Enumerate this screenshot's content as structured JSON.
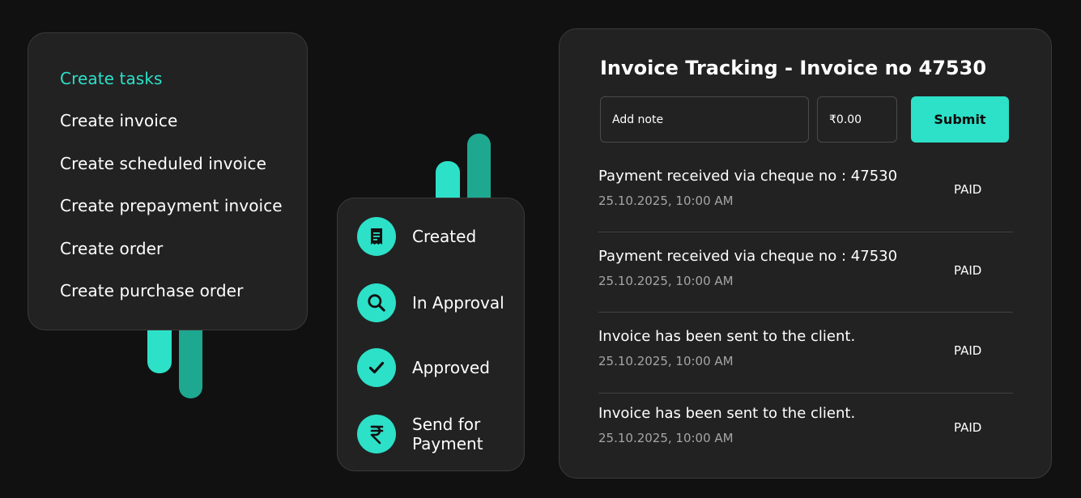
{
  "colors": {
    "accent": "#2de0c8",
    "accent_dark": "#1ea890",
    "card": "#222222",
    "background": "#111111"
  },
  "menu": {
    "items": [
      {
        "label": "Create tasks",
        "active": true
      },
      {
        "label": "Create invoice"
      },
      {
        "label": "Create scheduled invoice"
      },
      {
        "label": "Create prepayment invoice"
      },
      {
        "label": "Create order"
      },
      {
        "label": "Create purchase order"
      }
    ]
  },
  "status_steps": [
    {
      "label": "Created",
      "icon": "receipt-icon"
    },
    {
      "label": "In Approval",
      "icon": "search-icon"
    },
    {
      "label": "Approved",
      "icon": "checkmark-icon"
    },
    {
      "label": "Send for Payment",
      "icon": "rupee-icon"
    }
  ],
  "invoice": {
    "title": "Invoice Tracking - Invoice no 47530",
    "note_placeholder": "Add note",
    "amount_placeholder": "₹0.00",
    "submit_label": "Submit",
    "entries": [
      {
        "description": "Payment received via cheque no : 47530",
        "time": "25.10.2025, 10:00 AM",
        "status": "PAID"
      },
      {
        "description": "Payment received via cheque no : 47530",
        "time": "25.10.2025, 10:00 AM",
        "status": "PAID"
      },
      {
        "description": "Invoice has been sent to the client.",
        "time": "25.10.2025, 10:00 AM",
        "status": "PAID"
      },
      {
        "description": "Invoice has been sent to the client.",
        "time": "25.10.2025, 10:00 AM",
        "status": "PAID"
      }
    ]
  }
}
